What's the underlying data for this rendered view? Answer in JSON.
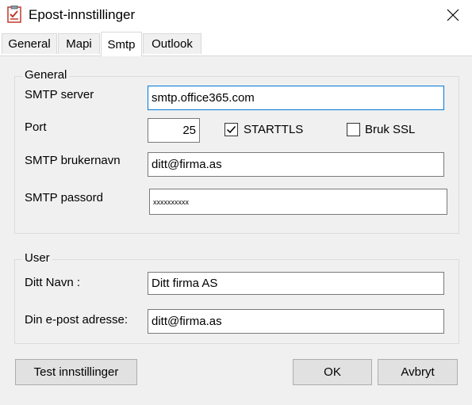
{
  "window": {
    "title": "Epost-innstillinger",
    "icon": "checklist-app-icon"
  },
  "tabs": [
    {
      "label": "General",
      "active": false
    },
    {
      "label": "Mapi",
      "active": false
    },
    {
      "label": "Smtp",
      "active": true
    },
    {
      "label": "Outlook",
      "active": false
    }
  ],
  "general_group": {
    "legend": "General",
    "smtp_server": {
      "label": "SMTP server",
      "value": "smtp.office365.com"
    },
    "port": {
      "label": "Port",
      "value": "25"
    },
    "starttls": {
      "label": "STARTTLS",
      "checked": true
    },
    "ssl": {
      "label": "Bruk SSL",
      "checked": false
    },
    "username": {
      "label": "SMTP brukernavn",
      "value": "ditt@firma.as"
    },
    "password": {
      "label": "SMTP passord",
      "value": "xxxxxxxxxx"
    }
  },
  "user_group": {
    "legend": "User",
    "name": {
      "label": "Ditt Navn :",
      "value": "Ditt firma AS"
    },
    "email": {
      "label": "Din e-post adresse:",
      "value": "ditt@firma.as"
    }
  },
  "buttons": {
    "test": "Test innstillinger",
    "ok": "OK",
    "cancel": "Avbryt"
  }
}
